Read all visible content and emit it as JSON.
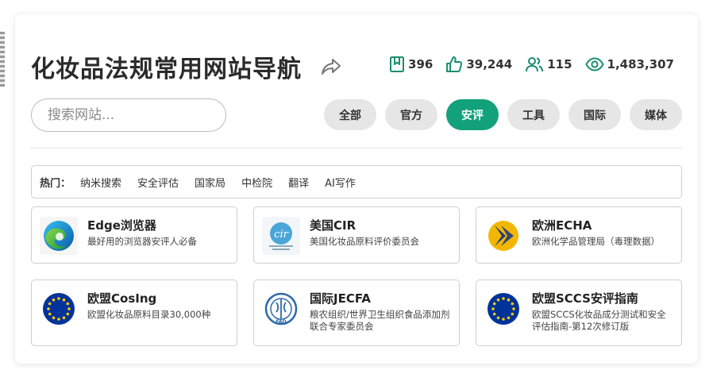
{
  "header": {
    "title": "化妆品法规常用网站导航"
  },
  "stats": {
    "bookmarks": "396",
    "likes": "39,244",
    "users": "115",
    "views": "1,483,307"
  },
  "search": {
    "placeholder": "搜索网站..."
  },
  "filters": [
    {
      "label": "全部",
      "active": false
    },
    {
      "label": "官方",
      "active": false
    },
    {
      "label": "安评",
      "active": true
    },
    {
      "label": "工具",
      "active": false
    },
    {
      "label": "国际",
      "active": false
    },
    {
      "label": "媒体",
      "active": false
    }
  ],
  "hot": {
    "label": "热门：",
    "links": [
      "纳米搜索",
      "安全评估",
      "国家局",
      "中检院",
      "翻译",
      "AI写作"
    ]
  },
  "sites": [
    {
      "name": "Edge浏览器",
      "desc": "最好用的浏览器安评人必备",
      "icon": "edge-icon"
    },
    {
      "name": "美国CIR",
      "desc": "美国化妆品原料评价委员会",
      "icon": "cir-icon"
    },
    {
      "name": "欧洲ECHA",
      "desc": "欧洲化学品管理局（毒理数据）",
      "icon": "echa-icon"
    },
    {
      "name": "欧盟CosIng",
      "desc": "欧盟化妆品原料目录30,000种",
      "icon": "eu-flag-icon"
    },
    {
      "name": "国际JECFA",
      "desc": "粮农组织/世界卫生组织食品添加剂联合专家委员会",
      "icon": "fao-icon"
    },
    {
      "name": "欧盟SCCS安评指南",
      "desc": "欧盟SCCS化妆品成分测试和安全评估指南-第12次修订版",
      "icon": "eu-flag-icon"
    }
  ],
  "colors": {
    "accent": "#12a17b",
    "filter_bg": "#e6e6e6",
    "stat_icon": "#1a8f6c"
  }
}
